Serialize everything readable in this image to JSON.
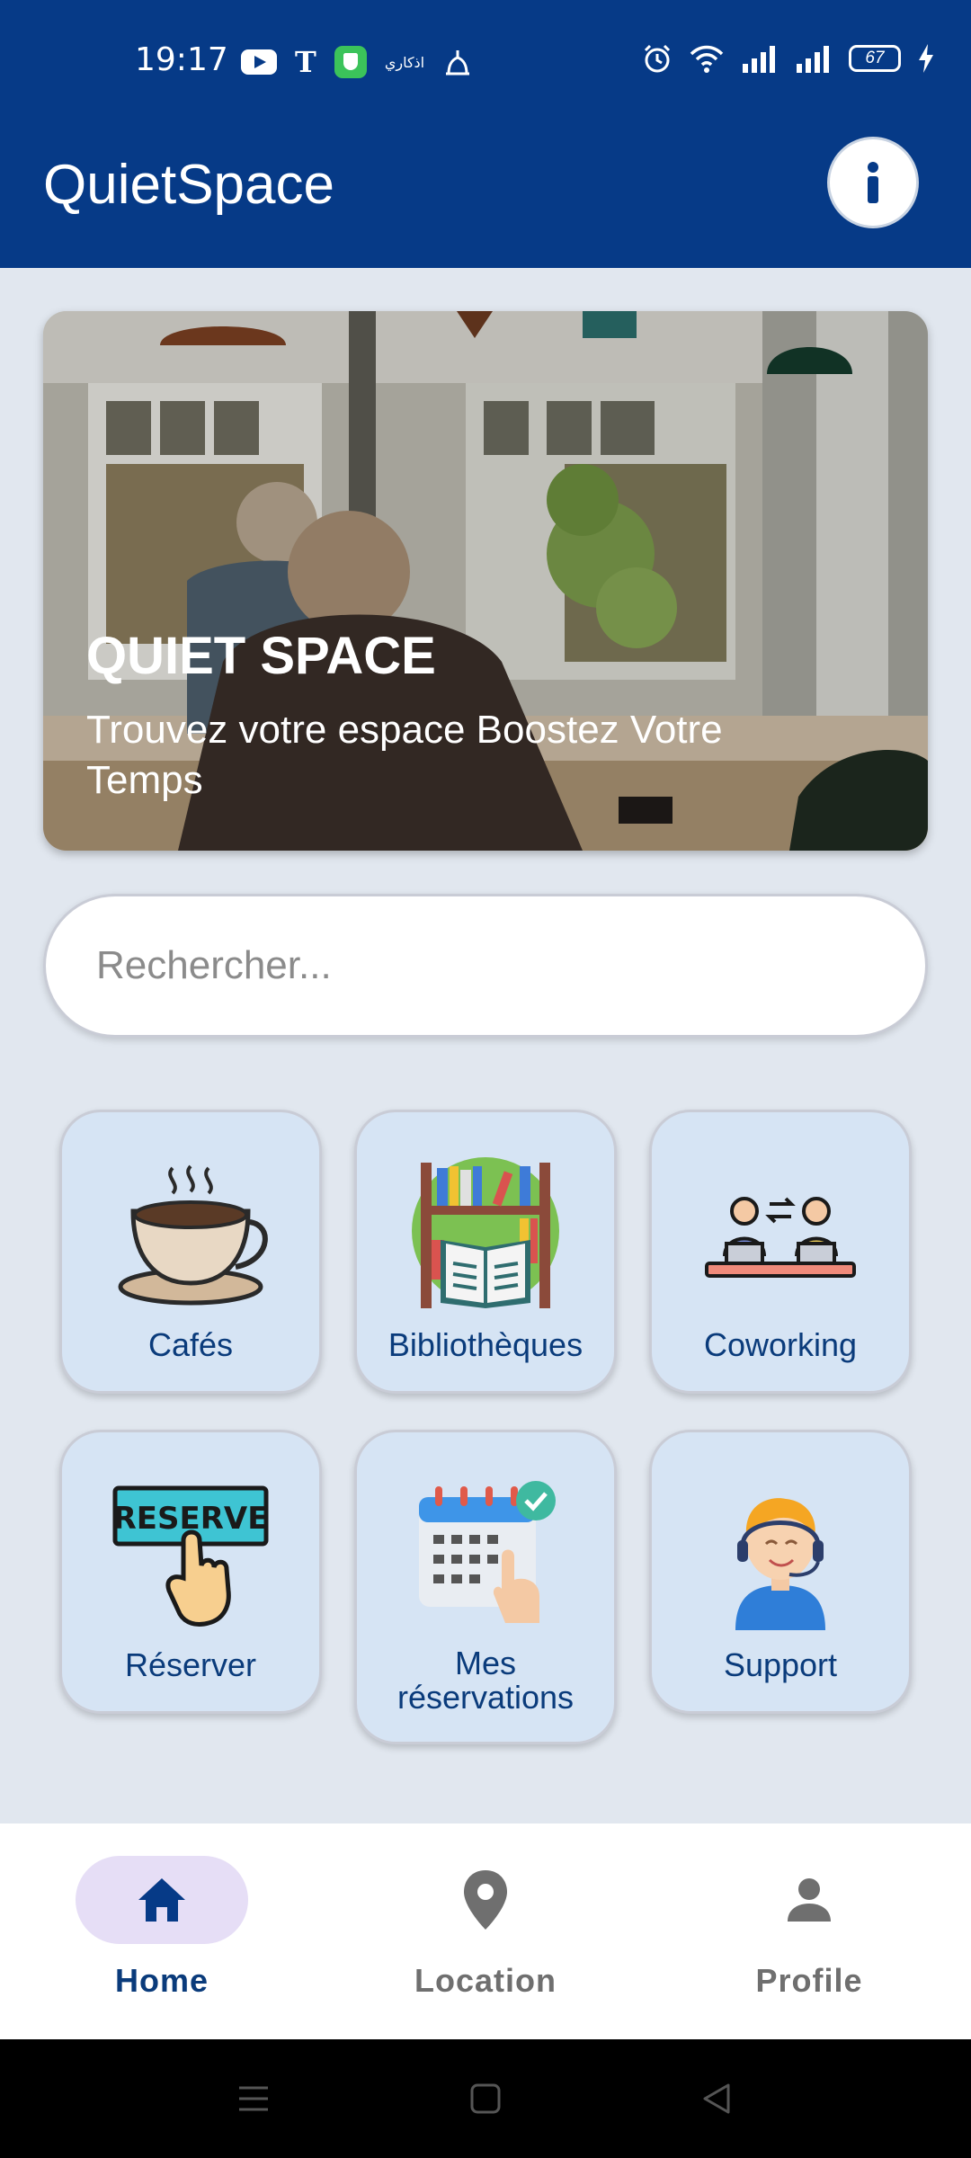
{
  "status_bar": {
    "time": "19:17",
    "arabic_label": "اذكاري",
    "battery": "67",
    "icons": [
      "youtube-icon",
      "t-icon",
      "shield-icon",
      "arabic-app-icon",
      "prayer-icon",
      "alarm-icon",
      "wifi-icon",
      "signal-icon",
      "signal-icon",
      "battery-icon",
      "charging-icon"
    ]
  },
  "app_bar": {
    "title": "QuietSpace",
    "info_icon": "info-icon"
  },
  "hero": {
    "title": "QUIET SPACE",
    "subtitle": "Trouvez votre espace Boostez Votre Temps"
  },
  "search": {
    "placeholder": "Rechercher..."
  },
  "categories": [
    {
      "label": "Cafés",
      "icon": "coffee-cup-icon"
    },
    {
      "label": "Bibliothèques",
      "icon": "bookshelf-icon"
    },
    {
      "label": "Coworking",
      "icon": "coworking-icon"
    },
    {
      "label": "Réserver",
      "icon": "reserve-icon"
    },
    {
      "label": "Mes réservations",
      "icon": "calendar-check-icon"
    },
    {
      "label": "Support",
      "icon": "support-agent-icon"
    }
  ],
  "bottom_nav": {
    "items": [
      {
        "label": "Home",
        "icon": "home-icon",
        "active": true
      },
      {
        "label": "Location",
        "icon": "location-pin-icon",
        "active": false
      },
      {
        "label": "Profile",
        "icon": "person-icon",
        "active": false
      }
    ]
  },
  "colors": {
    "primary": "#063a87",
    "background": "#e1e7ef",
    "tile": "#d6e4f4",
    "tile_text": "#0a3b7b",
    "active_pill": "#e6def6"
  }
}
